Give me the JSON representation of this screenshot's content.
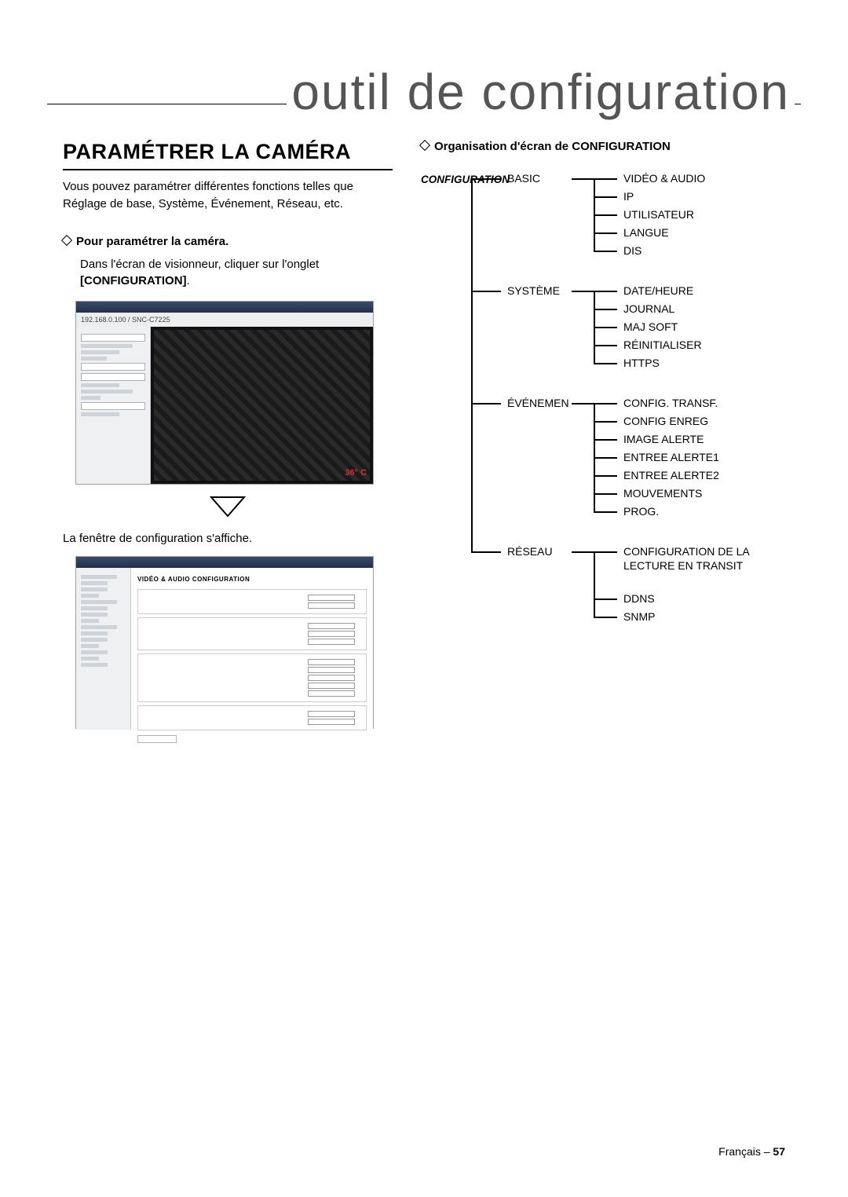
{
  "banner": {
    "title": "outil de configuration"
  },
  "left": {
    "section_title": "PARAMÉTRER LA CAMÉRA",
    "intro": "Vous pouvez paramétrer différentes fonctions telles que Réglage de base, Système, Événement, Réseau, etc.",
    "sub_h": "Pour paramétrer la caméra.",
    "step1_a": "Dans l'écran de visionneur, cliquer sur l'onglet ",
    "step1_b": "[CONFIGURATION]",
    "step1_c": ".",
    "shot1_ip": "192.168.0.100 / SNC-C7225",
    "shot1_badge": "36° C",
    "caption": "La fenêtre de configuration s'affiche.",
    "shot2_title": "VIDÉO & AUDIO CONFIGURATION"
  },
  "right": {
    "title": "Organisation d'écran de CONFIGURATION",
    "root": "CONFIGURATION",
    "tree": {
      "basic": {
        "label": "BASIC",
        "items": [
          "VIDÉO & AUDIO",
          "IP",
          "UTILISATEUR",
          "LANGUE",
          "DIS"
        ]
      },
      "systeme": {
        "label": "SYSTÈME",
        "items": [
          "DATE/HEURE",
          "JOURNAL",
          "MAJ SOFT",
          "RÉINITIALISER",
          "HTTPS"
        ]
      },
      "evenemen": {
        "label": "ÉVÉNEMEN",
        "items": [
          "CONFIG. TRANSF.",
          "CONFIG ENREG",
          "IMAGE ALERTE",
          "ENTREE ALERTE1",
          "ENTREE ALERTE2",
          "MOUVEMENTS",
          "PROG."
        ]
      },
      "reseau": {
        "label": "RÉSEAU",
        "items": [
          "CONFIGURATION DE LA LECTURE EN TRANSIT",
          "DDNS",
          "SNMP"
        ]
      }
    }
  },
  "footer": {
    "lang": "Français – ",
    "page": "57"
  }
}
